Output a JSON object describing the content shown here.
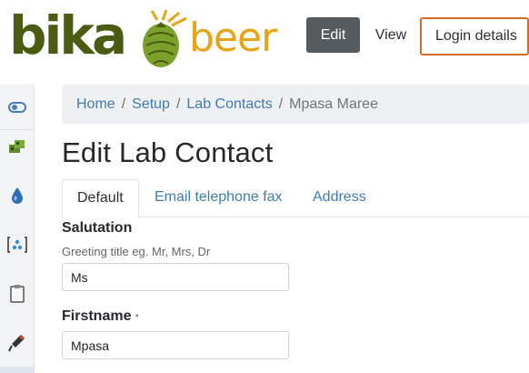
{
  "logo": {
    "part1": "bika",
    "part2": "beer"
  },
  "header": {
    "edit_label": "Edit",
    "view_label": "View",
    "login_label": "Login details"
  },
  "sidebar": {
    "items": [
      {
        "icon": "toggle-icon"
      },
      {
        "icon": "instruments-icon"
      },
      {
        "icon": "water-drop-icon"
      },
      {
        "icon": "sample-points-icon"
      },
      {
        "icon": "clipboard-icon"
      },
      {
        "icon": "microscope-icon"
      }
    ]
  },
  "breadcrumb": {
    "items": [
      "Home",
      "Setup",
      "Lab Contacts"
    ],
    "current": "Mpasa Maree",
    "separator": "/"
  },
  "page": {
    "title": "Edit Lab Contact"
  },
  "tabs": [
    {
      "label": "Default",
      "active": true
    },
    {
      "label": "Email telephone fax",
      "active": false
    },
    {
      "label": "Address",
      "active": false
    }
  ],
  "form": {
    "salutation": {
      "label": "Salutation",
      "help": "Greeting title eg. Mr, Mrs, Dr",
      "value": "Ms"
    },
    "firstname": {
      "label": "Firstname",
      "required_marker": "·",
      "value": "Mpasa"
    }
  },
  "colors": {
    "accent_link": "#3f7bb3",
    "login_outline": "#d4702b",
    "edit_button": "#555b5f",
    "logo_green": "#4a5b12",
    "logo_orange": "#e8a316"
  }
}
